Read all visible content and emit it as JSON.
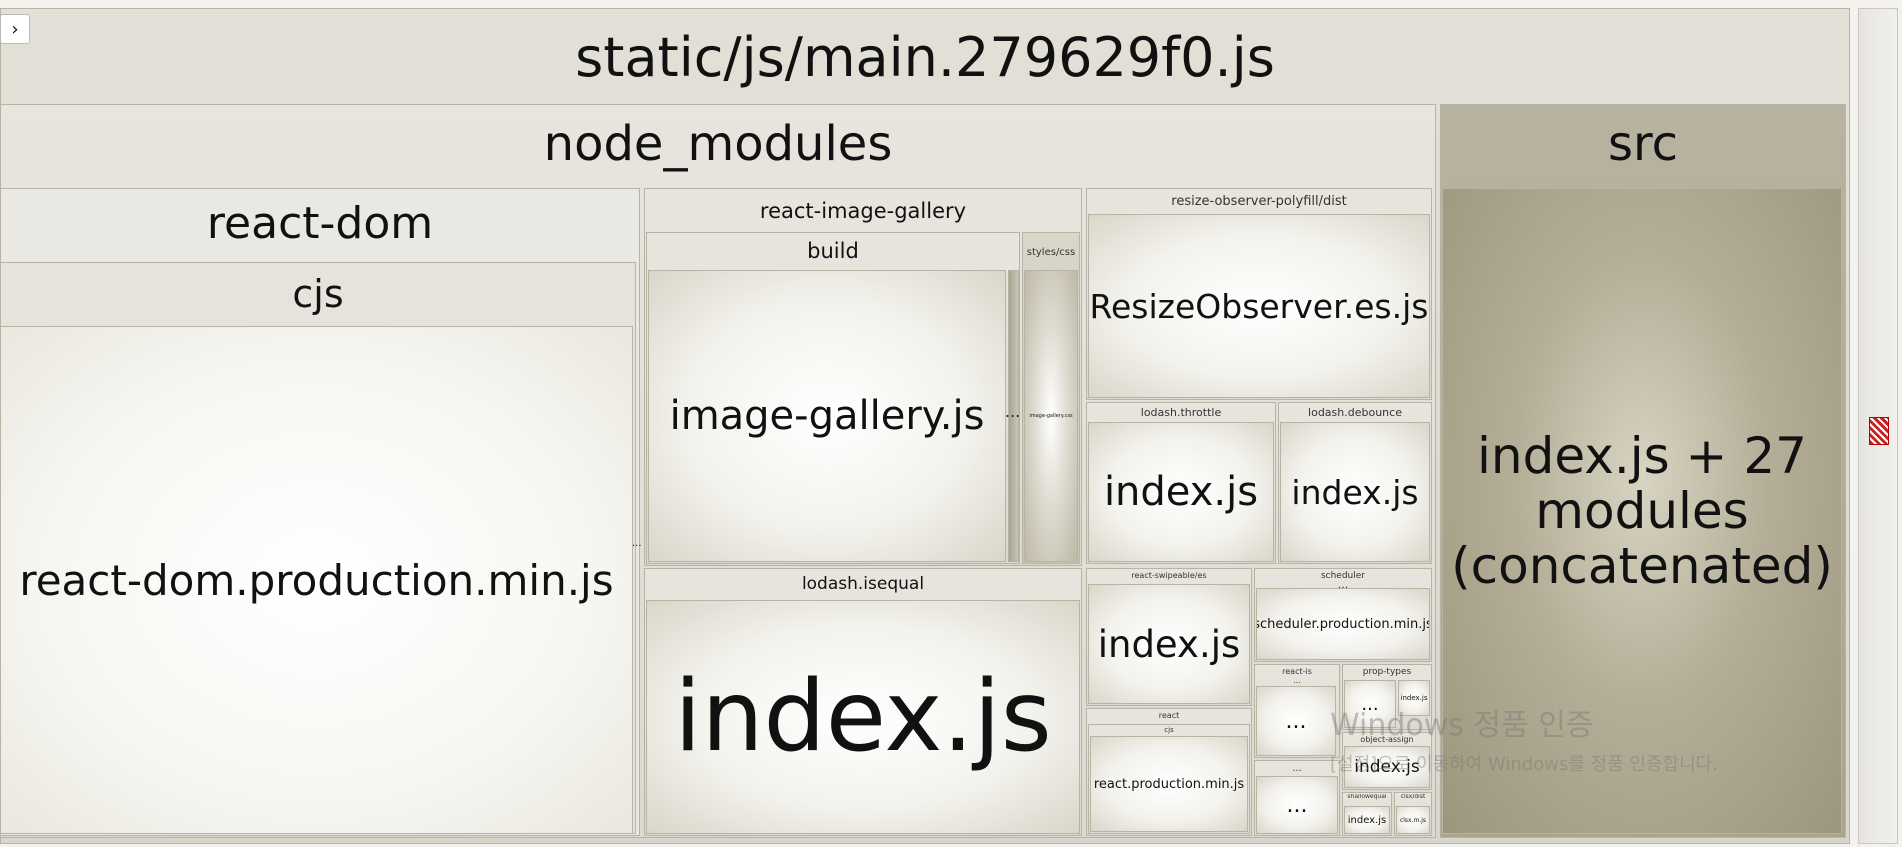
{
  "toggle": {
    "glyph": "›"
  },
  "root": {
    "title": "static/js/main.279629f0.js"
  },
  "node_modules": {
    "title": "node_modules",
    "react_dom": {
      "title": "react-dom",
      "cjs": "cjs",
      "file": "react-dom.production.min.js"
    },
    "gallery": {
      "title": "react-image-gallery",
      "build": "build",
      "file": "image-gallery.js",
      "styles": "styles/css",
      "css_file": "image-gallery.css"
    },
    "resize": {
      "title": "resize-observer-polyfill/dist",
      "file": "ResizeObserver.es.js"
    },
    "throttle": {
      "title": "lodash.throttle",
      "file": "index.js"
    },
    "debounce": {
      "title": "lodash.debounce",
      "file": "index.js"
    },
    "isequal": {
      "title": "lodash.isequal",
      "file": "index.js"
    },
    "swipeable": {
      "title": "react-swipeable/es",
      "file": "index.js"
    },
    "scheduler": {
      "title": "scheduler",
      "file": "scheduler.production.min.js"
    },
    "react": {
      "title": "react",
      "cjs": "cjs",
      "file": "react.production.min.js"
    },
    "react_is": {
      "title": "react-is"
    },
    "prop_types": {
      "title": "prop-types",
      "file": "index.js"
    },
    "object_assign": {
      "title": "object-assign",
      "file": "index.js"
    },
    "shallowequal": {
      "title": "shallowequal",
      "file": "index.js"
    },
    "clsx": {
      "title": "clsx/dist",
      "file": "clsx.m.js"
    },
    "ellipsis": "..."
  },
  "src": {
    "title": "src",
    "file": "index.js + 27 modules (concatenated)"
  },
  "watermark": {
    "line1": "Windows 정품 인증",
    "line2": "[설정]으로 이동하여 Windows를 정품 인증합니다."
  },
  "colors": {
    "group": "#dcdad0",
    "leaf": "#f6f5f1",
    "src": "#a8a28a",
    "border": "#b8b4a4"
  }
}
